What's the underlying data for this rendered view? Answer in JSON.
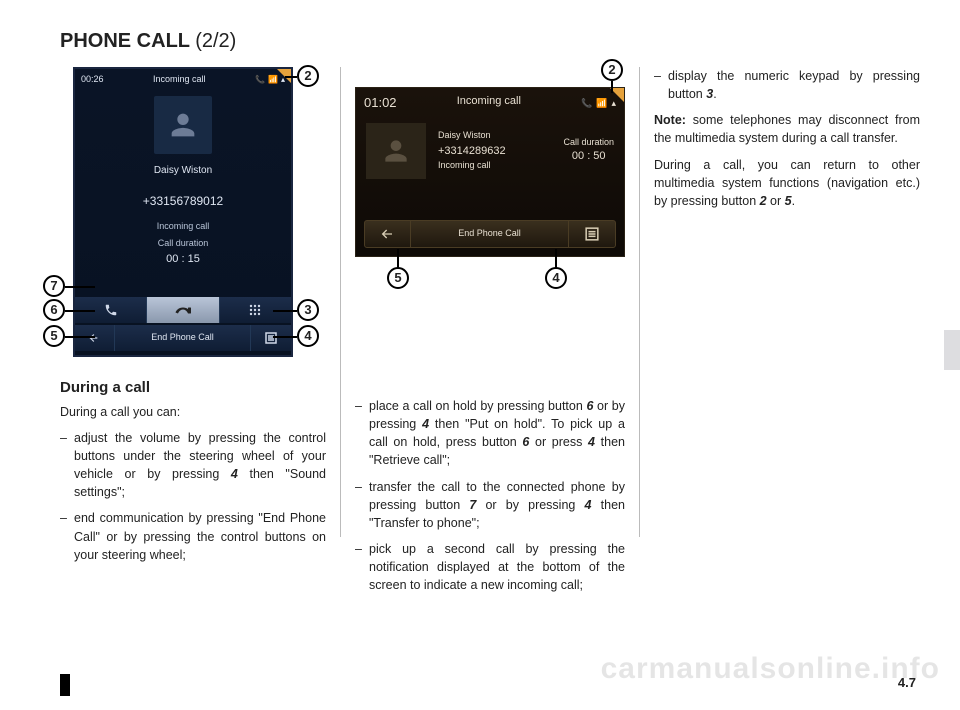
{
  "title_main": "PHONE CALL",
  "title_part": "(2/2)",
  "page_number": "4.7",
  "watermark": "carmanualsonline.info",
  "shot1": {
    "clock": "00:26",
    "header": "Incoming call",
    "name": "Daisy Wiston",
    "number": "+33156789012",
    "status": "Incoming call",
    "duration_label": "Call duration",
    "duration_value": "00 : 15",
    "row2_mid": "End Phone Call"
  },
  "shot2": {
    "clock": "01:02",
    "header": "Incoming call",
    "name": "Daisy Wiston",
    "number": "+3314289632",
    "status": "Incoming call",
    "duration_label": "Call duration",
    "duration_value": "00 : 50",
    "bottom_mid": "End Phone Call"
  },
  "callouts": {
    "c2": "2",
    "c3": "3",
    "c4": "4",
    "c5": "5",
    "c6": "6",
    "c7": "7"
  },
  "col1": {
    "heading": "During a call",
    "intro": "During a call you can:",
    "b1": "adjust the volume by pressing the control buttons under the steering wheel of your vehicle or by press­ing ",
    "b1_bold": "4",
    "b1_tail": " then \"Sound settings\";",
    "b2": "end communication by pressing \"End Phone Call\" or by pressing the con­trol buttons on your steering wheel;"
  },
  "col2": {
    "b1a": "place a call on hold by pressing button ",
    "b1b": "6",
    "b1c": " or by pressing ",
    "b1d": "4",
    "b1e": " then \"Put on hold\". To pick up a call on hold, press button ",
    "b1f": "6",
    "b1g": " or press ",
    "b1h": "4",
    "b1i": " then \"Retrieve call\";",
    "b2a": "transfer the call to the connected phone by pressing button ",
    "b2b": "7",
    "b2c": " or by pressing ",
    "b2d": "4",
    "b2e": " then \"Transfer to phone\";",
    "b3": "pick up a second call by pressing the notification displayed at the bottom of the screen to indicate a new in­coming call;"
  },
  "col3": {
    "b1a": "display the numeric keypad by press­ing button ",
    "b1b": "3",
    "b1c": ".",
    "p2a": "Note:",
    "p2b": " some telephones may discon­nect from the multimedia system during a call transfer.",
    "p3a": "During a call, you can return to other multimedia system functions (naviga­tion etc.) by pressing button ",
    "p3b": "2",
    "p3c": " or ",
    "p3d": "5",
    "p3e": "."
  }
}
